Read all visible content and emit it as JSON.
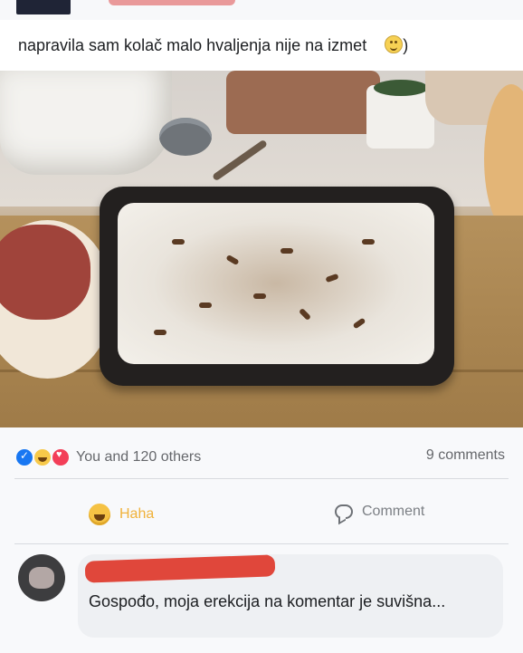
{
  "post": {
    "caption": "napravila sam kolač malo hvaljenja nije na izmet",
    "caption_suffix": ")"
  },
  "reactions": {
    "summary": "You and 120 others",
    "comments_count": "9 comments"
  },
  "actions": {
    "haha_label": "Haha",
    "comment_label": "Comment"
  },
  "comment": {
    "text": "Gospođo, moja erekcija na komentar je suvišna..."
  },
  "colors": {
    "like_blue": "#1877f2",
    "love_red": "#f33e58",
    "haha_yellow": "#f7c94a",
    "redaction_red": "#e0473b"
  }
}
